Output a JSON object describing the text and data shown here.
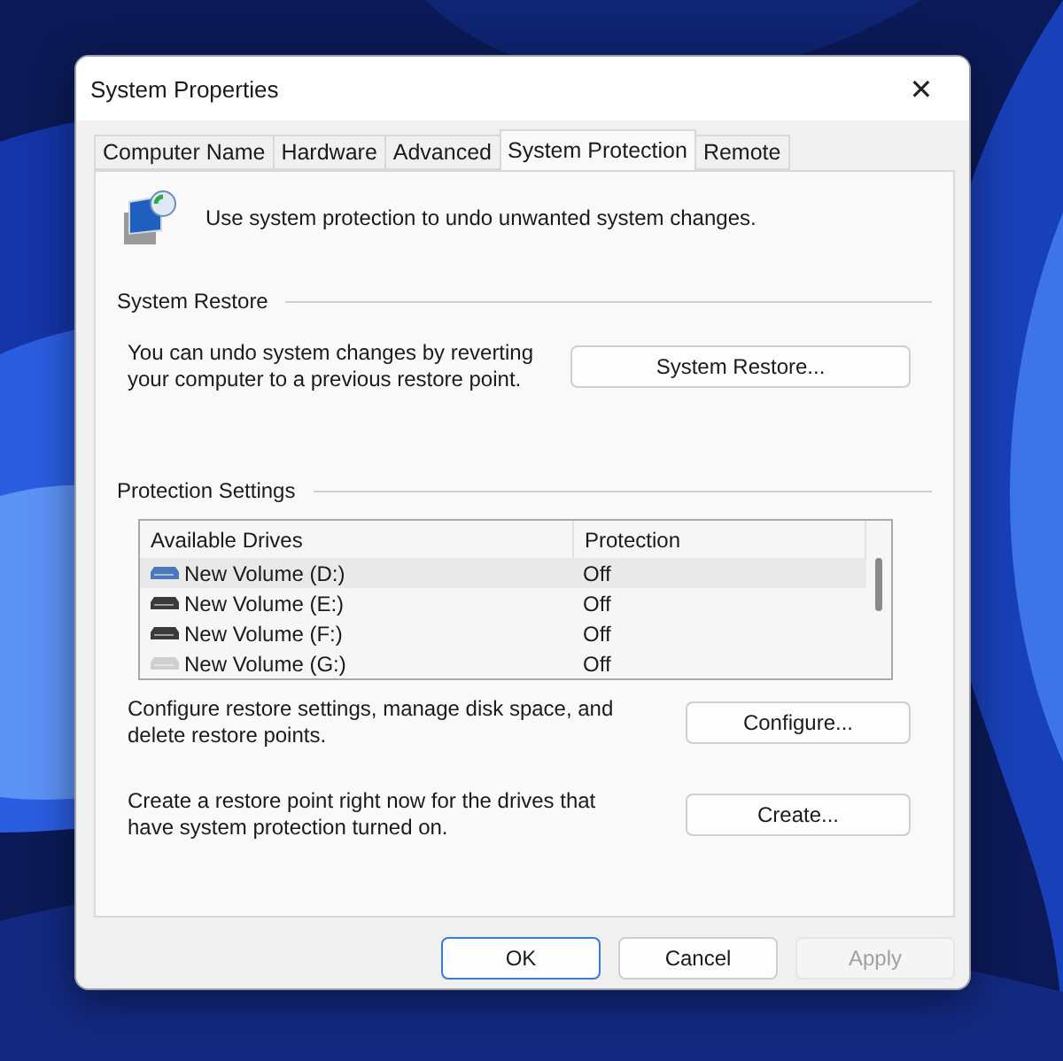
{
  "window": {
    "title": "System Properties",
    "close": "✕"
  },
  "tabs": [
    {
      "label": "Computer Name",
      "selected": false
    },
    {
      "label": "Hardware",
      "selected": false
    },
    {
      "label": "Advanced",
      "selected": false
    },
    {
      "label": "System Protection",
      "selected": true
    },
    {
      "label": "Remote",
      "selected": false
    }
  ],
  "intro": "Use system protection to undo unwanted system changes.",
  "system_restore": {
    "heading": "System Restore",
    "text": "You can undo system changes by reverting your computer to a previous restore point.",
    "button": "System Restore..."
  },
  "protection_settings": {
    "heading": "Protection Settings",
    "columns": [
      "Available Drives",
      "Protection"
    ],
    "rows": [
      {
        "drive": "New Volume (D:)",
        "protection": "Off",
        "selected": true,
        "kind": "blue"
      },
      {
        "drive": "New Volume (E:)",
        "protection": "Off",
        "selected": false,
        "kind": "dark"
      },
      {
        "drive": "New Volume (F:)",
        "protection": "Off",
        "selected": false,
        "kind": "dark"
      },
      {
        "drive": "New Volume (G:)",
        "protection": "Off",
        "selected": false,
        "kind": "light"
      }
    ],
    "configure_text": "Configure restore settings, manage disk space, and delete restore points.",
    "configure_button": "Configure...",
    "create_text": "Create a restore point right now for the drives that have system protection turned on.",
    "create_button": "Create..."
  },
  "buttons": [
    {
      "label": "OK",
      "default": true,
      "disabled": false
    },
    {
      "label": "Cancel",
      "default": false,
      "disabled": false
    },
    {
      "label": "Apply",
      "default": false,
      "disabled": true
    }
  ]
}
